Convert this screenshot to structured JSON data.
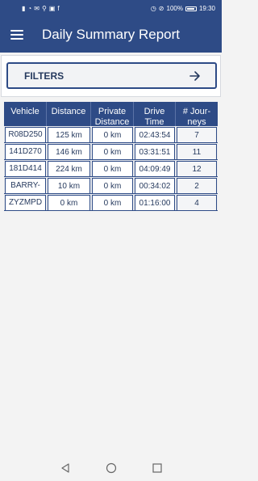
{
  "status_bar": {
    "left_icons": [
      "signal-icon",
      "wifi-icon",
      "mail-icon",
      "usb-icon",
      "image-icon",
      "facebook-icon"
    ],
    "battery_percent": "100%",
    "time": "19:30"
  },
  "app_bar": {
    "title": "Daily Summary Report"
  },
  "filters": {
    "label": "FILTERS"
  },
  "table": {
    "headers": [
      "Vehicle",
      "Distance",
      "Private Distance",
      "Drive Time",
      "# Jour- neys"
    ],
    "rows": [
      {
        "vehicle": "R08D250",
        "distance": "125 km",
        "private": "0 km",
        "drive_time": "02:43:54",
        "journeys": "7"
      },
      {
        "vehicle": "141D270",
        "distance": "146 km",
        "private": "0 km",
        "drive_time": "03:31:51",
        "journeys": "11"
      },
      {
        "vehicle": "181D414",
        "distance": "224 km",
        "private": "0 km",
        "drive_time": "04:09:49",
        "journeys": "12"
      },
      {
        "vehicle": "BARRY-",
        "distance": "10 km",
        "private": "0 km",
        "drive_time": "00:34:02",
        "journeys": "2"
      },
      {
        "vehicle": "ZYZMPD",
        "distance": "0 km",
        "private": "0 km",
        "drive_time": "01:16:00",
        "journeys": "4"
      }
    ]
  },
  "colors": {
    "primary": "#2e4b86",
    "text": "#263a5e",
    "background": "#f3f3f3"
  }
}
